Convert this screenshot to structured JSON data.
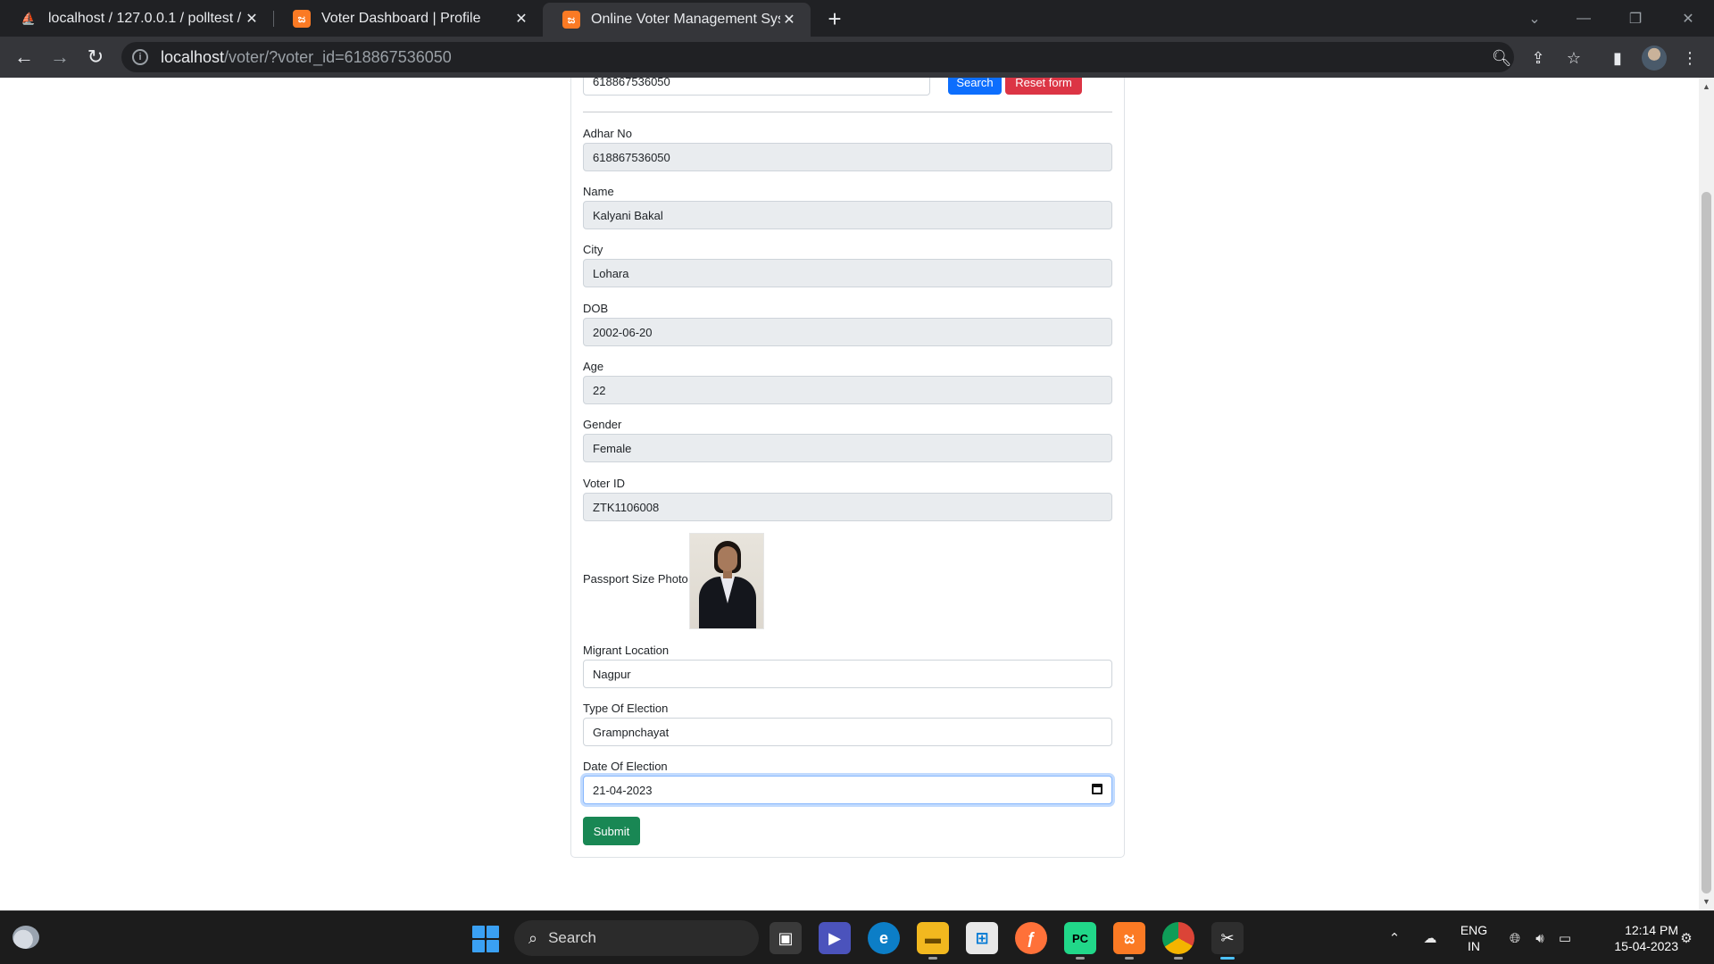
{
  "browser": {
    "tabs": [
      {
        "title": "localhost / 127.0.0.1 / polltest / v",
        "icon": "phpmyadmin-icon"
      },
      {
        "title": "Voter Dashboard | Profile",
        "icon": "xampp-icon"
      },
      {
        "title": "Online Voter Management Syster",
        "icon": "xampp-icon"
      }
    ],
    "url_host": "localhost",
    "url_path": "/voter/?voter_id=618867536050"
  },
  "search": {
    "value": "618867536050",
    "search_label": "Search",
    "reset_label": "Reset form"
  },
  "form": {
    "fields": [
      {
        "label": "Adhar No",
        "value": "618867536050"
      },
      {
        "label": "Name",
        "value": "Kalyani Bakal"
      },
      {
        "label": "City",
        "value": "Lohara"
      },
      {
        "label": "DOB",
        "value": "2002-06-20"
      },
      {
        "label": "Age",
        "value": "22"
      },
      {
        "label": "Gender",
        "value": "Female"
      },
      {
        "label": "Voter ID",
        "value": "ZTK1106008"
      }
    ],
    "photo_label": "Passport Size Photo",
    "editable": [
      {
        "label": "Migrant Location",
        "value": "Nagpur"
      },
      {
        "label": "Type Of Election",
        "value": "Grampnchayat"
      },
      {
        "label": "Date Of Election",
        "value": "21-04-2023"
      }
    ],
    "submit_label": "Submit"
  },
  "taskbar": {
    "search_placeholder": "Search",
    "lang_line1": "ENG",
    "lang_line2": "IN",
    "time": "12:14 PM",
    "date": "15-04-2023"
  },
  "colors": {
    "primary": "#0d6efd",
    "danger": "#dc3545",
    "success": "#198754",
    "readonly_bg": "#e9ecef"
  }
}
